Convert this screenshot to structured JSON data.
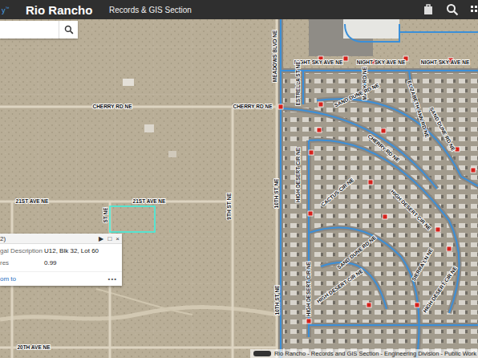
{
  "header": {
    "brand": "y",
    "brand_mark": "™",
    "title": "Rio Rancho",
    "section": "Records & GIS Section"
  },
  "search": {
    "value": ""
  },
  "map": {
    "street_labels": [
      "NIGHT SKY AVE NE",
      "NIGHT SKY AVE NE",
      "NIGHT SKY AVE NE",
      "MEADOWS BLVD NE",
      "ESTRELLA ST NE",
      "MARK RD NE",
      "ELIZABETH ANN RD NE",
      "SAND DUNE RD NE",
      "SAND DUNE RD NE",
      "CHERRY RD NE",
      "CHERRY RD NE",
      "CHERRY RD NE",
      "HIGH DESERT CIR NE",
      "10TH ST NE",
      "CACTUS CIR NE",
      "HIGH DESERT CIR NE",
      "SAND DUNE RD NE",
      "HIGH DESERT CIR NE",
      "SIERRA LN NE",
      "HIGH DESERT CIR NE",
      "21ST AVE NE",
      "21ST AVE NE",
      "ST NE",
      "9TH ST NE",
      "10TH ST NE",
      "HIGH DESERT CIR NE",
      "20TH AVE NE"
    ],
    "selected_parcel": {
      "highlighted": true
    }
  },
  "popup": {
    "title": "2)",
    "controls": [
      "▶",
      "□",
      "×"
    ],
    "fields": [
      {
        "label": "gal Description",
        "value": "U12, Blk 32, Lot 60"
      },
      {
        "label": "res",
        "value": "0.99"
      }
    ],
    "link": "om to",
    "more": "•••"
  },
  "attribution": "Rio Rancho - Records and GIS Section - Engineering Division - Public Work"
}
